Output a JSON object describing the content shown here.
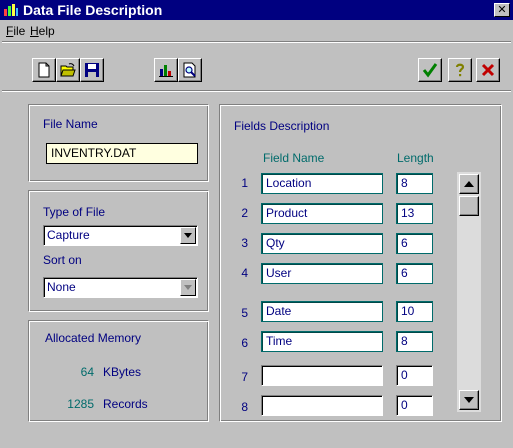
{
  "window": {
    "title": "Data File Description",
    "close_glyph": "✕"
  },
  "menu": [
    {
      "label": "File",
      "accel": "F"
    },
    {
      "label": "Help",
      "accel": "H"
    }
  ],
  "toolbar": {
    "left_icons": [
      "new-file-icon",
      "open-folder-icon",
      "save-disk-icon"
    ],
    "right_icons": [
      "bar-chart-icon",
      "preview-magnifier-icon"
    ],
    "ok_icon": "checkmark-icon",
    "help_icon": "question-mark-icon",
    "cancel_icon": "x-icon",
    "colors": {
      "ok": "#008000",
      "help": "#808000",
      "cancel": "#c00000"
    }
  },
  "file_name": {
    "label": "File Name",
    "value": "INVENTRY.DAT"
  },
  "type_of_file": {
    "label": "Type of File",
    "value": "Capture",
    "sort_label": "Sort on",
    "sort_value": "None"
  },
  "memory": {
    "label": "Allocated Memory",
    "kbytes_value": "64",
    "kbytes_unit": "KBytes",
    "records_value": "1285",
    "records_unit": "Records"
  },
  "fields": {
    "label": "Fields Description",
    "col_name": "Field Name",
    "col_length": "Length",
    "rows": [
      {
        "num": "1",
        "name": "Location",
        "length": "8"
      },
      {
        "num": "2",
        "name": "Product",
        "length": "13"
      },
      {
        "num": "3",
        "name": "Qty",
        "length": "6"
      },
      {
        "num": "4",
        "name": "User",
        "length": "6"
      },
      {
        "num": "5",
        "name": "Date",
        "length": "10"
      },
      {
        "num": "6",
        "name": "Time",
        "length": "8"
      },
      {
        "num": "7",
        "name": "",
        "length": "0"
      },
      {
        "num": "8",
        "name": "",
        "length": "0"
      }
    ]
  }
}
